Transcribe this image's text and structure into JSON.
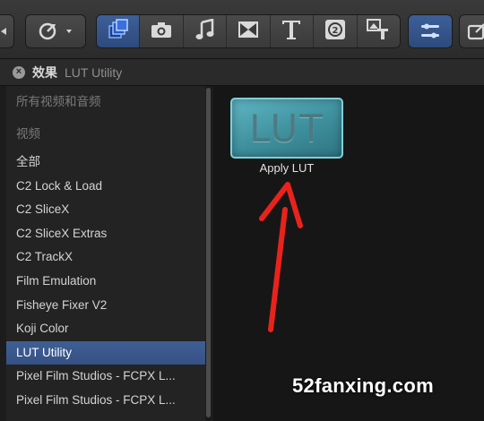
{
  "toolbar": {
    "buttons": [
      {
        "icon": "chevron-left-icon"
      },
      {
        "icon": "retime-icon"
      },
      {
        "icon": "effects-browser-icon",
        "active": true
      },
      {
        "icon": "photo-browser-icon"
      },
      {
        "icon": "music-browser-icon"
      },
      {
        "icon": "transitions-browser-icon"
      },
      {
        "icon": "titles-browser-icon"
      },
      {
        "icon": "generators-browser-icon"
      },
      {
        "icon": "themes-browser-icon"
      },
      {
        "icon": "inspector-icon",
        "active": true
      },
      {
        "icon": "share-icon"
      }
    ]
  },
  "panel": {
    "title": "效果",
    "subtitle": "LUT Utility"
  },
  "categories": [
    {
      "label": "所有视频和音频",
      "style": "dim"
    },
    {
      "label": "视频",
      "style": "dim"
    },
    {
      "label": "全部",
      "style": "normal"
    },
    {
      "label": "C2 Lock & Load",
      "style": "normal"
    },
    {
      "label": "C2 SliceX",
      "style": "normal"
    },
    {
      "label": "C2 SliceX Extras",
      "style": "normal"
    },
    {
      "label": "C2 TrackX",
      "style": "normal"
    },
    {
      "label": "Film Emulation",
      "style": "normal"
    },
    {
      "label": "Fisheye Fixer V2",
      "style": "normal"
    },
    {
      "label": "Koji Color",
      "style": "normal"
    },
    {
      "label": "LUT Utility",
      "style": "selected"
    },
    {
      "label": "Pixel Film Studios - FCPX L...",
      "style": "normal"
    },
    {
      "label": "Pixel Film Studios - FCPX L...",
      "style": "normal"
    }
  ],
  "effect": {
    "thumbnail_text": "LUT",
    "label": "Apply LUT"
  },
  "watermark": "52fanxing.com",
  "colors": {
    "selection": "#3f5f94",
    "arrow": "#e8231c",
    "thumbnail": "#4fa6b3"
  }
}
